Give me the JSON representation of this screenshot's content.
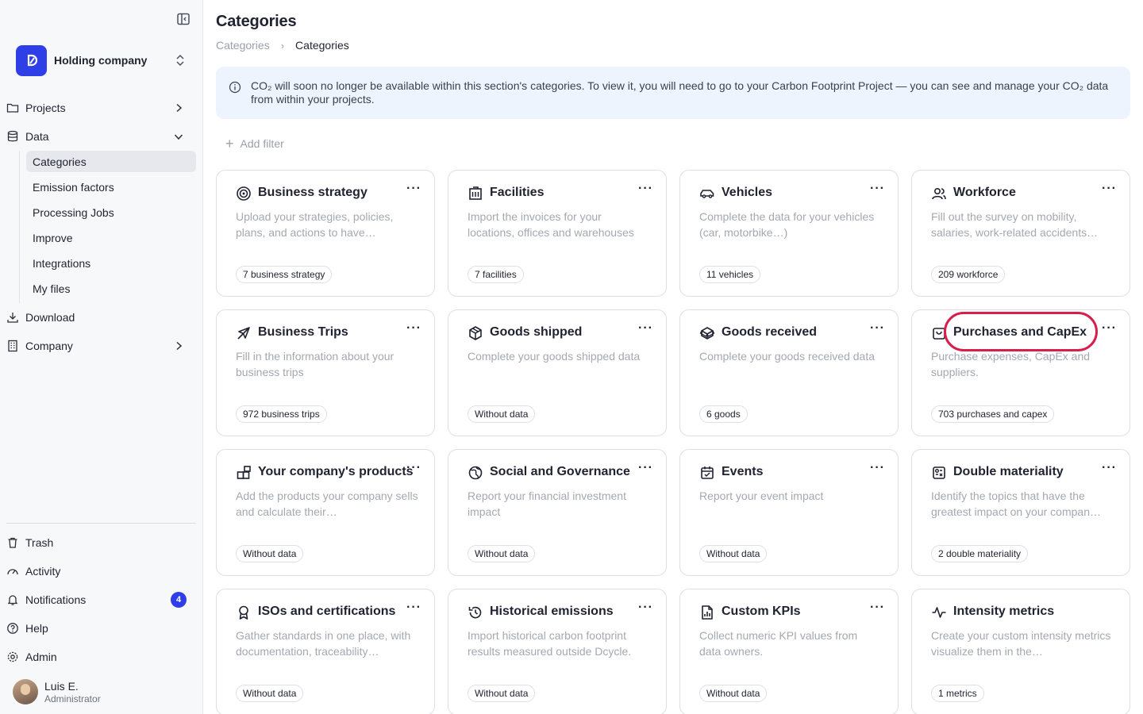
{
  "sidebar": {
    "org_name": "Holding company",
    "nav": {
      "projects": "Projects",
      "data": "Data",
      "download": "Download",
      "company": "Company"
    },
    "data_items": [
      "Categories",
      "Emission factors",
      "Processing Jobs",
      "Improve",
      "Integrations",
      "My files"
    ],
    "bottom": {
      "trash": "Trash",
      "activity": "Activity",
      "notifications": "Notifications",
      "notifications_count": "4",
      "help": "Help",
      "admin": "Admin"
    },
    "user": {
      "name": "Luis E.",
      "role": "Administrator"
    },
    "accent_color": "#2f3fe8"
  },
  "header": {
    "title": "Categories",
    "breadcrumb": [
      "Categories",
      "Categories"
    ]
  },
  "info_banner": "CO₂ will soon no longer be available within this section's categories. To view it, you will need to go to your Carbon Footprint Project — you can see and manage your CO₂ data from within your projects.",
  "filter": {
    "add_label": "Add filter"
  },
  "cards": [
    {
      "title": "Business strategy",
      "icon": "target-icon",
      "desc": "Upload your strategies, policies, plans, and actions to have…",
      "tag": "7 business strategy"
    },
    {
      "title": "Facilities",
      "icon": "building-icon",
      "desc": "Import the invoices for your locations, offices and warehouses",
      "tag": "7 facilities"
    },
    {
      "title": "Vehicles",
      "icon": "car-icon",
      "desc": "Complete the data for your vehicles (car, motorbike…)",
      "tag": "11 vehicles"
    },
    {
      "title": "Workforce",
      "icon": "users-icon",
      "desc": "Fill out the survey on mobility, salaries, work-related accidents…",
      "tag": "209 workforce"
    },
    {
      "title": "Business Trips",
      "icon": "plane-icon",
      "desc": "Fill in the information about your business trips",
      "tag": "972 business trips"
    },
    {
      "title": "Goods shipped",
      "icon": "package-icon",
      "desc": "Complete your goods shipped data",
      "tag": "Without data"
    },
    {
      "title": "Goods received",
      "icon": "box-open-icon",
      "desc": "Complete your goods received data",
      "tag": "6 goods"
    },
    {
      "title": "Purchases and CapEx",
      "icon": "shopping-bag-icon",
      "desc": "Purchase expenses, CapEx and suppliers.",
      "tag": "703 purchases and capex"
    },
    {
      "title": "Your company's products",
      "icon": "blocks-icon",
      "desc": "Add the products your company sells and calculate their…",
      "tag": "Without data"
    },
    {
      "title": "Social and Governance",
      "icon": "globe-icon",
      "desc": "Report your financial investment impact",
      "tag": "Without data"
    },
    {
      "title": "Events",
      "icon": "calendar-icon",
      "desc": "Report your event impact",
      "tag": "Without data"
    },
    {
      "title": "Double materiality",
      "icon": "matrix-icon",
      "desc": "Identify the topics that have the greatest impact on your compan…",
      "tag": "2 double materiality"
    },
    {
      "title": "ISOs and certifications",
      "icon": "award-icon",
      "desc": "Gather standards in one place, with documentation, traceability…",
      "tag": "Without data"
    },
    {
      "title": "Historical emissions",
      "icon": "history-icon",
      "desc": "Import historical carbon footprint results measured outside Dcycle.",
      "tag": "Without data"
    },
    {
      "title": "Custom KPIs",
      "icon": "file-chart-icon",
      "desc": "Collect numeric KPI values from data owners.",
      "tag": "Without data"
    },
    {
      "title": "Intensity metrics",
      "icon": "activity-icon",
      "desc": "Create your custom intensity metrics visualize them in the…",
      "tag": "1 metrics"
    }
  ],
  "more_label": "···",
  "highlight_color": "#d81e4a"
}
